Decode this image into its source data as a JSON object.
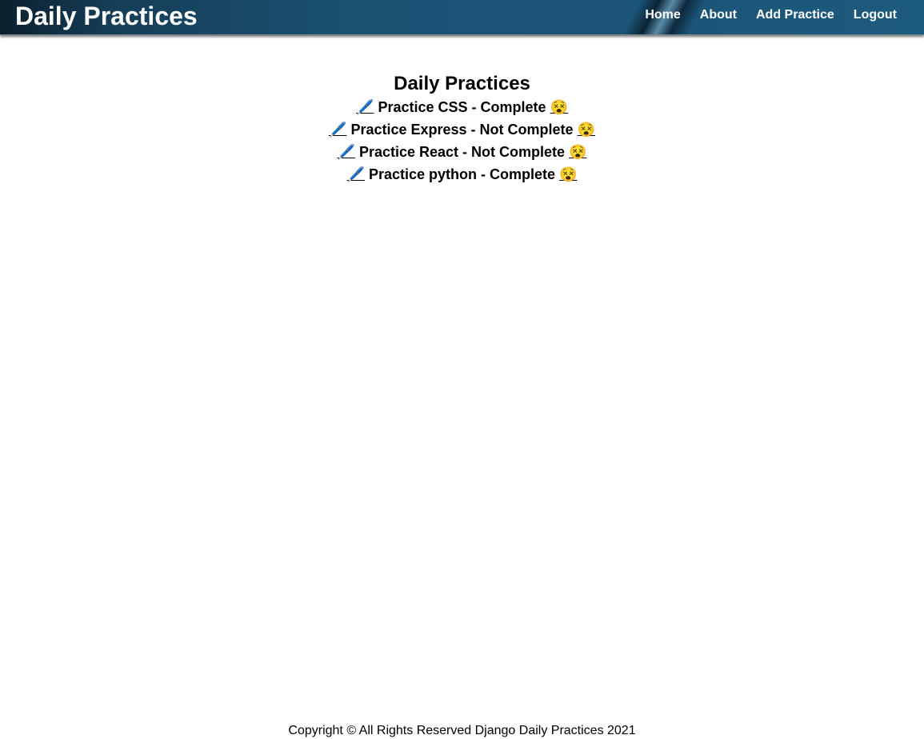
{
  "header": {
    "brand": "Daily Practices",
    "nav": [
      {
        "label": "Home"
      },
      {
        "label": "About"
      },
      {
        "label": "Add Practice"
      },
      {
        "label": "Logout"
      }
    ]
  },
  "main": {
    "title": "Daily Practices",
    "practices": [
      {
        "edit_icon": "🖊️",
        "text": "Practice CSS - Complete",
        "delete_icon": "😵"
      },
      {
        "edit_icon": "🖊️",
        "text": "Practice Express - Not Complete",
        "delete_icon": "😵"
      },
      {
        "edit_icon": "🖊️",
        "text": "Practice React - Not Complete",
        "delete_icon": "😵"
      },
      {
        "edit_icon": "🖊️",
        "text": "Practice python - Complete",
        "delete_icon": "😵"
      }
    ]
  },
  "footer": {
    "text": "Copyright © All Rights Reserved Django Daily Practices 2021"
  },
  "colors": {
    "navbar": "#1b5477",
    "nav_text": "#ffffff",
    "body_text": "#000000",
    "background": "#ffffff"
  },
  "icons": {
    "edit": "pen-icon",
    "delete": "dizzy-face-icon"
  }
}
